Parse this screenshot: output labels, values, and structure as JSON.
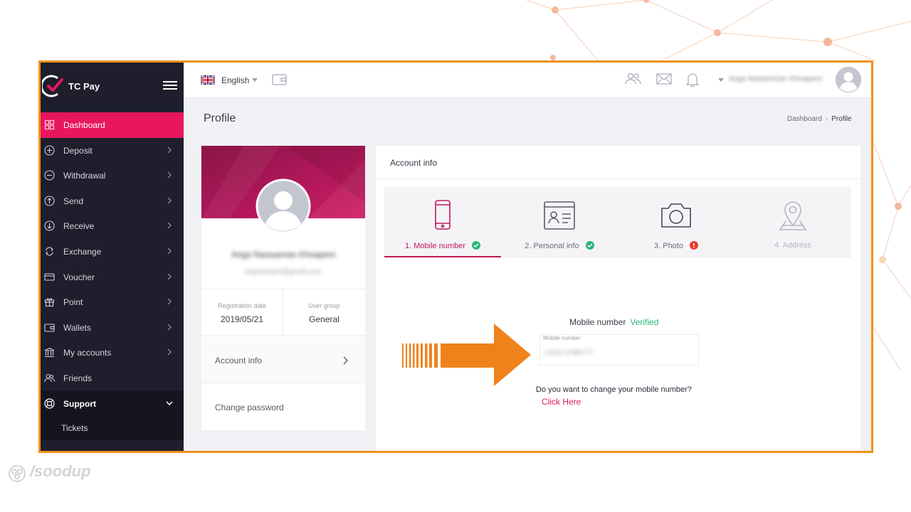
{
  "brand": {
    "name": "TC Pay"
  },
  "sidebar": {
    "items": [
      {
        "label": "Dashboard",
        "icon": "grid-icon"
      },
      {
        "label": "Deposit",
        "icon": "plus-circle-icon"
      },
      {
        "label": "Withdrawal",
        "icon": "minus-circle-icon"
      },
      {
        "label": "Send",
        "icon": "arrow-up-circle-icon"
      },
      {
        "label": "Receive",
        "icon": "arrow-down-circle-icon"
      },
      {
        "label": "Exchange",
        "icon": "exchange-icon"
      },
      {
        "label": "Voucher",
        "icon": "card-icon"
      },
      {
        "label": "Point",
        "icon": "gift-icon"
      },
      {
        "label": "Wallets",
        "icon": "wallet-icon"
      },
      {
        "label": "My accounts",
        "icon": "bank-icon"
      },
      {
        "label": "Friends",
        "icon": "friends-icon"
      },
      {
        "label": "Support",
        "icon": "lifebuoy-icon"
      }
    ],
    "sub_items": [
      {
        "label": "Tickets"
      }
    ]
  },
  "topbar": {
    "language": "English",
    "user_name": "Arga Nasseerian Khoapeni"
  },
  "page": {
    "title": "Profile",
    "breadcrumb": [
      "Dashboard",
      "Profile"
    ]
  },
  "profile": {
    "name": "Ariga Nassaerian Khoapeni",
    "email": "argnassaeri@gmail.com",
    "registration_label": "Registration date",
    "registration_value": "2019/05/21",
    "group_label": "User group",
    "group_value": "General",
    "menu": [
      "Account info",
      "Change password"
    ]
  },
  "account": {
    "title": "Account info",
    "steps": [
      {
        "label": "1. Mobile number",
        "status": "verified"
      },
      {
        "label": "2. Personal info",
        "status": "verified"
      },
      {
        "label": "3. Photo",
        "status": "warning"
      },
      {
        "label": "4. Address",
        "status": "disabled"
      }
    ],
    "mobile": {
      "heading": "Mobile number",
      "status": "Verified",
      "field_label": "Mobile number",
      "field_value": "+2314 6788777",
      "question": "Do you want to change your mobile number?",
      "link": "Click Here"
    }
  },
  "watermark": "/soodup",
  "colors": {
    "accent": "#e8175d",
    "frame": "#f0901c",
    "success": "#2bb67a",
    "warning": "#e83a2e",
    "sidebar": "#1e1e2c",
    "arrow": "#f0821c"
  }
}
